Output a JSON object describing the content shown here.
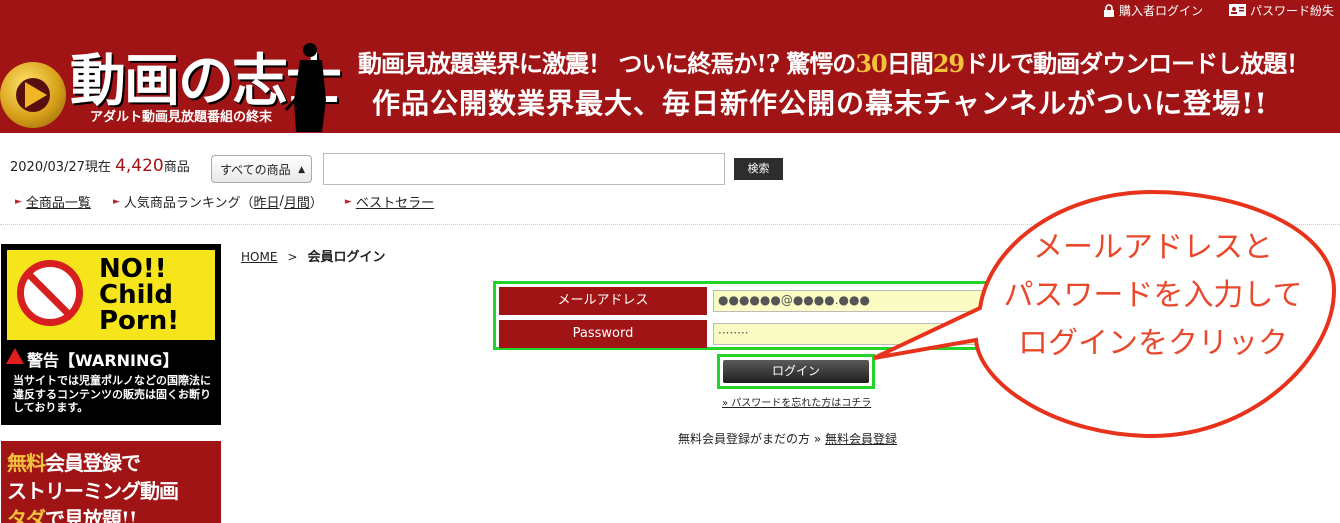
{
  "header": {
    "top_links": {
      "buyer_login": "購入者ログイン",
      "password_lost": "パスワード紛失"
    },
    "logo": {
      "title": "動画の志士",
      "subtitle": "アダルト動画見放題番組の終末"
    },
    "banner": {
      "line1_part1": "動画見放題業界に激震！ ついに終焉か!? 驚愕の",
      "line1_num1": "30",
      "line1_part2": "日間",
      "line1_num2": "29",
      "line1_part3": "ドルで動画ダウンロードし放題！",
      "line2": "作品公開数業界最大、毎日新作公開の幕末チャンネルがついに登場!!"
    }
  },
  "search": {
    "date_prefix": "2020/03/27現在",
    "count": "4,420",
    "count_suffix": "商品",
    "category_selected": "すべての商品",
    "button_label": "検索"
  },
  "nav": {
    "all_products": "全商品一覧",
    "ranking_label": "人気商品ランキング（",
    "yesterday": "昨日",
    "slash": " / ",
    "monthly": "月間",
    "ranking_close": "）",
    "bestseller": "ベストセラー"
  },
  "sidebar": {
    "no_child_line1": "NO!!",
    "no_child_line2": "Child",
    "no_child_line3": "Porn!",
    "warning_title": "警告【WARNING】",
    "warning_text": "当サイトでは児童ポルノなどの国際法に違反するコンテンツの販売は固くお断りしております。",
    "free_line1_y": "無料",
    "free_line1": "会員登録で",
    "free_line2": "ストリーミング動画",
    "free_line3_y": "タダ",
    "free_line3": "で見放題!!"
  },
  "breadcrumb": {
    "home": "HOME",
    "sep": ">",
    "current": "会員ログイン"
  },
  "login": {
    "email_label": "メールアドレス",
    "email_value": "●●●●●●@●●●●.●●●",
    "password_label": "Password",
    "password_value": "········",
    "login_button": "ログイン",
    "forgot_link": "» パスワードを忘れた方はコチラ",
    "register_prompt": "無料会員登録がまだの方 »",
    "register_link": "無料会員登録"
  },
  "callout": {
    "line1": "メールアドレスと",
    "line2": "パスワードを入力して",
    "line3": "ログインをクリック"
  },
  "colors": {
    "brand_red": "#a01416",
    "highlight_green": "#22d42a",
    "callout_orange": "#e8492c"
  }
}
